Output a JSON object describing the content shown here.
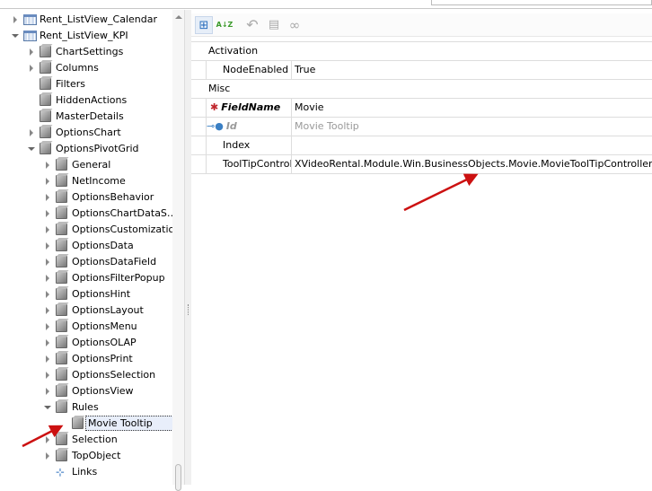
{
  "tree": {
    "items": [
      {
        "label": "Rent_ListView_Calendar",
        "level": 0,
        "state": "collapsed",
        "icon": "listview-icon"
      },
      {
        "label": "Rent_ListView_KPI",
        "level": 0,
        "state": "expanded",
        "icon": "listview-icon"
      },
      {
        "label": "ChartSettings",
        "level": 1,
        "state": "collapsed",
        "icon": "node-icon"
      },
      {
        "label": "Columns",
        "level": 1,
        "state": "collapsed",
        "icon": "node-icon"
      },
      {
        "label": "Filters",
        "level": 1,
        "state": "leaf",
        "icon": "node-icon"
      },
      {
        "label": "HiddenActions",
        "level": 1,
        "state": "leaf",
        "icon": "node-icon"
      },
      {
        "label": "MasterDetails",
        "level": 1,
        "state": "leaf",
        "icon": "node-icon"
      },
      {
        "label": "OptionsChart",
        "level": 1,
        "state": "collapsed",
        "icon": "node-icon"
      },
      {
        "label": "OptionsPivotGrid",
        "level": 1,
        "state": "expanded",
        "icon": "node-icon"
      },
      {
        "label": "General",
        "level": 2,
        "state": "collapsed",
        "icon": "node-icon"
      },
      {
        "label": "NetIncome",
        "level": 2,
        "state": "collapsed",
        "icon": "node-icon"
      },
      {
        "label": "OptionsBehavior",
        "level": 2,
        "state": "collapsed",
        "icon": "node-icon"
      },
      {
        "label": "OptionsChartDataS…",
        "level": 2,
        "state": "collapsed",
        "icon": "node-icon"
      },
      {
        "label": "OptionsCustomization",
        "level": 2,
        "state": "collapsed",
        "icon": "node-icon"
      },
      {
        "label": "OptionsData",
        "level": 2,
        "state": "collapsed",
        "icon": "node-icon"
      },
      {
        "label": "OptionsDataField",
        "level": 2,
        "state": "collapsed",
        "icon": "node-icon"
      },
      {
        "label": "OptionsFilterPopup",
        "level": 2,
        "state": "collapsed",
        "icon": "node-icon"
      },
      {
        "label": "OptionsHint",
        "level": 2,
        "state": "collapsed",
        "icon": "node-icon"
      },
      {
        "label": "OptionsLayout",
        "level": 2,
        "state": "collapsed",
        "icon": "node-icon"
      },
      {
        "label": "OptionsMenu",
        "level": 2,
        "state": "collapsed",
        "icon": "node-icon"
      },
      {
        "label": "OptionsOLAP",
        "level": 2,
        "state": "collapsed",
        "icon": "node-icon"
      },
      {
        "label": "OptionsPrint",
        "level": 2,
        "state": "collapsed",
        "icon": "node-icon"
      },
      {
        "label": "OptionsSelection",
        "level": 2,
        "state": "collapsed",
        "icon": "node-icon"
      },
      {
        "label": "OptionsView",
        "level": 2,
        "state": "collapsed",
        "icon": "node-icon"
      },
      {
        "label": "Rules",
        "level": 2,
        "state": "expanded",
        "icon": "node-icon"
      },
      {
        "label": "Movie Tooltip",
        "level": 3,
        "state": "leaf",
        "icon": "node-icon",
        "selected": true
      },
      {
        "label": "Selection",
        "level": 2,
        "state": "collapsed",
        "icon": "node-icon"
      },
      {
        "label": "TopObject",
        "level": 2,
        "state": "collapsed",
        "icon": "node-icon"
      },
      {
        "label": "Links",
        "level": 2,
        "state": "leaf",
        "icon": "links-icon"
      }
    ]
  },
  "toolbar": {
    "categorized": "⊞",
    "alphabetical": "A↓Z",
    "undo": "↶",
    "pages": "▤",
    "link": "∞"
  },
  "grid": {
    "activation": "Activation",
    "node_enabled": {
      "name": "NodeEnabled",
      "value": "True"
    },
    "misc": "Misc",
    "field_name": {
      "name": "FieldName",
      "value": "Movie"
    },
    "id": {
      "name": "Id",
      "value": "Movie Tooltip"
    },
    "index": {
      "name": "Index",
      "value": ""
    },
    "tooltip": {
      "name": "ToolTipControlle",
      "value": "XVideoRental.Module.Win.BusinessObjects.Movie.MovieToolTipController"
    }
  },
  "colors": {
    "arrow": "#cc1111",
    "required": "#c0262c",
    "key": "#3a7fc4"
  }
}
